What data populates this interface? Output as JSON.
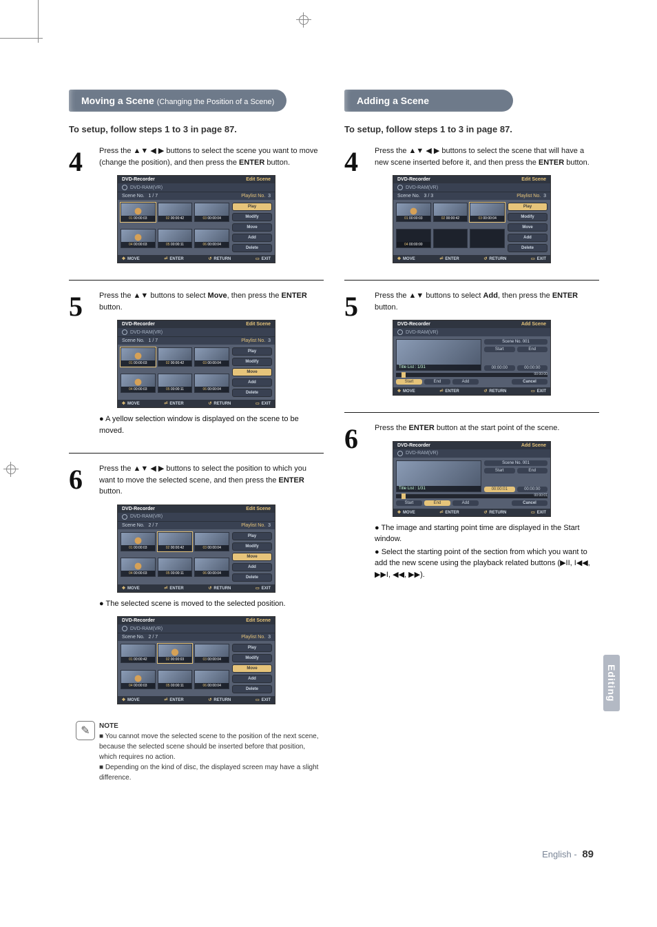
{
  "registration": true,
  "left": {
    "headerMain": "Moving a Scene",
    "headerSub": "(Changing the Position of a Scene)",
    "setup": "To setup, follow steps 1 to 3 in page 87.",
    "step4": {
      "num": "4",
      "text": "Press the ▲▼ ◀ ▶ buttons to select the scene you want to move (change the position), and then press the ENTER button."
    },
    "osd1": {
      "device": "DVD-Recorder",
      "title": "Edit Scene",
      "disc": "DVD-RAM(VR)",
      "sceneLbl": "Scene No.",
      "sceneVal": "1 / 7",
      "plLbl": "Playlist No.",
      "plVal": "3",
      "grid": [
        {
          "n": "01",
          "t": "00:00:03",
          "hl": true,
          "flower": true
        },
        {
          "n": "02",
          "t": "00:00:42"
        },
        {
          "n": "03",
          "t": "00:00:04"
        },
        {
          "n": "04",
          "t": "00:00:03",
          "flower": true
        },
        {
          "n": "05",
          "t": "00:00:11"
        },
        {
          "n": "06",
          "t": "00:00:04"
        }
      ],
      "menu": [
        {
          "l": "Play",
          "hl": true
        },
        {
          "l": "Modify"
        },
        {
          "l": "Move"
        },
        {
          "l": "Add"
        },
        {
          "l": "Delete"
        }
      ],
      "bot": {
        "move": "MOVE",
        "enter": "ENTER",
        "ret": "RETURN",
        "exit": "EXIT"
      }
    },
    "step5": {
      "num": "5",
      "text": "Press the ▲▼ buttons to select Move, then press the ENTER button."
    },
    "osd2": {
      "device": "DVD-Recorder",
      "title": "Edit Scene",
      "disc": "DVD-RAM(VR)",
      "sceneLbl": "Scene No.",
      "sceneVal": "1 / 7",
      "plLbl": "Playlist No.",
      "plVal": "3",
      "grid": [
        {
          "n": "01",
          "t": "00:00:03",
          "hl": true,
          "flower": true
        },
        {
          "n": "02",
          "t": "00:00:42"
        },
        {
          "n": "03",
          "t": "00:00:04"
        },
        {
          "n": "04",
          "t": "00:00:03",
          "flower": true
        },
        {
          "n": "05",
          "t": "00:00:11"
        },
        {
          "n": "06",
          "t": "00:00:04"
        }
      ],
      "menu": [
        {
          "l": "Play"
        },
        {
          "l": "Modify"
        },
        {
          "l": "Move",
          "hl": true
        },
        {
          "l": "Add"
        },
        {
          "l": "Delete"
        }
      ],
      "bot": {
        "move": "MOVE",
        "enter": "ENTER",
        "ret": "RETURN",
        "exit": "EXIT"
      }
    },
    "subnote5": "● A yellow selection window is displayed on the scene to be moved.",
    "step6": {
      "num": "6",
      "text": "Press the ▲▼ ◀ ▶ buttons to select the position to which you want to move the selected scene, and then press the ENTER button."
    },
    "osd3": {
      "device": "DVD-Recorder",
      "title": "Edit Scene",
      "disc": "DVD-RAM(VR)",
      "sceneLbl": "Scene No.",
      "sceneVal": "2 / 7",
      "plLbl": "Playlist No.",
      "plVal": "3",
      "grid": [
        {
          "n": "01",
          "t": "00:00:03",
          "flower": true
        },
        {
          "n": "02",
          "t": "00:00:42",
          "hl": true
        },
        {
          "n": "03",
          "t": "00:00:04"
        },
        {
          "n": "04",
          "t": "00:00:03",
          "flower": true
        },
        {
          "n": "05",
          "t": "00:00:11"
        },
        {
          "n": "06",
          "t": "00:00:04"
        }
      ],
      "menu": [
        {
          "l": "Play"
        },
        {
          "l": "Modify"
        },
        {
          "l": "Move",
          "hl": true
        },
        {
          "l": "Add"
        },
        {
          "l": "Delete"
        }
      ],
      "bot": {
        "move": "MOVE",
        "enter": "ENTER",
        "ret": "RETURN",
        "exit": "EXIT"
      }
    },
    "subnote6": "● The selected scene is moved to the selected position.",
    "osd4": {
      "device": "DVD-Recorder",
      "title": "Edit Scene",
      "disc": "DVD-RAM(VR)",
      "sceneLbl": "Scene No.",
      "sceneVal": "2 / 7",
      "plLbl": "Playlist No.",
      "plVal": "3",
      "grid": [
        {
          "n": "01",
          "t": "00:00:42"
        },
        {
          "n": "02",
          "t": "00:00:03",
          "hl": true,
          "flower": true
        },
        {
          "n": "03",
          "t": "00:00:04"
        },
        {
          "n": "04",
          "t": "00:00:03",
          "flower": true
        },
        {
          "n": "05",
          "t": "00:00:11"
        },
        {
          "n": "06",
          "t": "00:00:04"
        }
      ],
      "menu": [
        {
          "l": "Play"
        },
        {
          "l": "Modify"
        },
        {
          "l": "Move",
          "hl": true
        },
        {
          "l": "Add"
        },
        {
          "l": "Delete"
        }
      ],
      "bot": {
        "move": "MOVE",
        "enter": "ENTER",
        "ret": "RETURN",
        "exit": "EXIT"
      }
    },
    "note": {
      "label": "NOTE",
      "lines": [
        "■  You cannot move the selected scene to the position of the next scene, because the selected scene should be inserted before that position, which requires no action.",
        "■  Depending on the kind of disc, the displayed screen may have a slight difference."
      ]
    }
  },
  "right": {
    "headerMain": "Adding a Scene",
    "setup": "To setup, follow steps 1 to 3 in page 87.",
    "step4": {
      "num": "4",
      "text": "Press the ▲▼ ◀ ▶ buttons to select the scene that will have a new scene inserted before it, and then press the ENTER button."
    },
    "osd5": {
      "device": "DVD-Recorder",
      "title": "Edit Scene",
      "disc": "DVD-RAM(VR)",
      "sceneLbl": "Scene No.",
      "sceneVal": "3 / 3",
      "plLbl": "Playlist No.",
      "plVal": "3",
      "grid": [
        {
          "n": "01",
          "t": "00:00:03",
          "flower": true
        },
        {
          "n": "02",
          "t": "00:00:42"
        },
        {
          "n": "03",
          "t": "00:00:04",
          "hl": true
        },
        {
          "n": "04",
          "t": "00:00:00",
          "empty": true
        },
        {
          "empty": true,
          "blank": true
        },
        {
          "empty": true,
          "blank": true
        }
      ],
      "menu": [
        {
          "l": "Play",
          "hl": true
        },
        {
          "l": "Modify"
        },
        {
          "l": "Move"
        },
        {
          "l": "Add"
        },
        {
          "l": "Delete"
        }
      ],
      "bot": {
        "move": "MOVE",
        "enter": "ENTER",
        "ret": "RETURN",
        "exit": "EXIT"
      }
    },
    "step5": {
      "num": "5",
      "text": "Press the ▲▼ buttons to select Add, then press the ENTER button."
    },
    "osd6": {
      "device": "DVD-Recorder",
      "title": "Add Scene",
      "disc": "DVD-RAM(VR)",
      "titleList": "Title List : 1/31",
      "sceneNo": "Scene No. 001",
      "startLbl": "Start",
      "endLbl": "End",
      "startTc": "00:00:00",
      "endTc": "00:00:00",
      "timeEnd": "00:00:00",
      "brow": [
        "Start",
        "End",
        "Add"
      ],
      "cancel": "Cancel",
      "bot": {
        "move": "MOVE",
        "enter": "ENTER",
        "ret": "RETURN",
        "exit": "EXIT"
      }
    },
    "step6": {
      "num": "6",
      "text": "Press the ENTER button at the start point of the scene."
    },
    "osd7": {
      "device": "DVD-Recorder",
      "title": "Add Scene",
      "disc": "DVD-RAM(VR)",
      "titleList": "Title List : 1/31",
      "sceneNo": "Scene No. 001",
      "startLbl": "Start",
      "endLbl": "End",
      "startTc": "00:00:01",
      "endTc": "00:00:00",
      "timeEnd": "00:00:01",
      "brow": [
        "Start",
        "End",
        "Add"
      ],
      "cancel": "Cancel",
      "bot": {
        "move": "MOVE",
        "enter": "ENTER",
        "ret": "RETURN",
        "exit": "EXIT"
      }
    },
    "sub6a": "● The image and starting point time are displayed in the Start window.",
    "sub6b": "● Select the starting point of the section from which you want to add the new scene using the playback related buttons (▶II, I◀◀, ▶▶I, ◀◀, ▶▶)."
  },
  "sideTab": "Editing",
  "pageNum": "89",
  "pageLbl": "English -"
}
